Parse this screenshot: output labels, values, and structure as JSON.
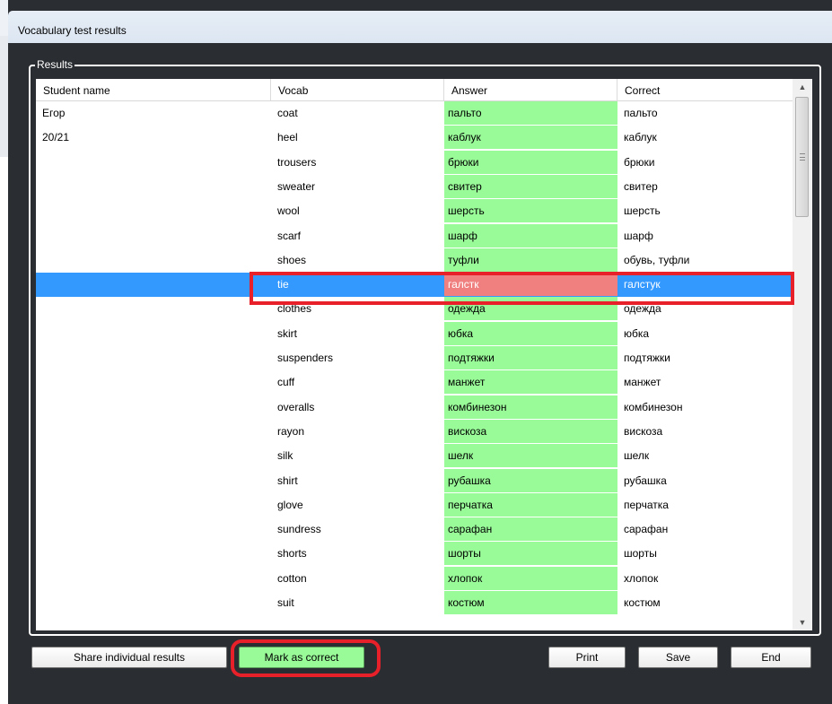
{
  "window": {
    "title": "Vocabulary test results"
  },
  "group": {
    "label": "Results"
  },
  "table": {
    "headers": [
      "Student name",
      "Vocab",
      "Answer",
      "Correct"
    ],
    "rows": [
      {
        "name": "Егор",
        "vocab": "coat",
        "answer": "пальто",
        "correct": "пальто",
        "status": "correct"
      },
      {
        "name": "20/21",
        "vocab": "heel",
        "answer": "каблук",
        "correct": "каблук",
        "status": "correct"
      },
      {
        "name": "",
        "vocab": "trousers",
        "answer": "брюки",
        "correct": "брюки",
        "status": "correct"
      },
      {
        "name": "",
        "vocab": "sweater",
        "answer": "свитер",
        "correct": "свитер",
        "status": "correct"
      },
      {
        "name": "",
        "vocab": "wool",
        "answer": "шерсть",
        "correct": "шерсть",
        "status": "correct"
      },
      {
        "name": "",
        "vocab": "scarf",
        "answer": "шарф",
        "correct": "шарф",
        "status": "correct"
      },
      {
        "name": "",
        "vocab": "shoes",
        "answer": "туфли",
        "correct": "обувь, туфли",
        "status": "correct"
      },
      {
        "name": "",
        "vocab": "tie",
        "answer": "галстк",
        "correct": "галстук",
        "status": "wrong",
        "selected": true
      },
      {
        "name": "",
        "vocab": "clothes",
        "answer": "одежда",
        "correct": "одежда",
        "status": "correct"
      },
      {
        "name": "",
        "vocab": "skirt",
        "answer": "юбка",
        "correct": "юбка",
        "status": "correct"
      },
      {
        "name": "",
        "vocab": "suspenders",
        "answer": "подтяжки",
        "correct": "подтяжки",
        "status": "correct"
      },
      {
        "name": "",
        "vocab": "cuff",
        "answer": "манжет",
        "correct": "манжет",
        "status": "correct"
      },
      {
        "name": "",
        "vocab": "overalls",
        "answer": "комбинезон",
        "correct": "комбинезон",
        "status": "correct"
      },
      {
        "name": "",
        "vocab": "rayon",
        "answer": "вискоза",
        "correct": "вискоза",
        "status": "correct"
      },
      {
        "name": "",
        "vocab": "silk",
        "answer": "шелк",
        "correct": "шелк",
        "status": "correct"
      },
      {
        "name": "",
        "vocab": "shirt",
        "answer": "рубашка",
        "correct": "рубашка",
        "status": "correct"
      },
      {
        "name": "",
        "vocab": "glove",
        "answer": "перчатка",
        "correct": "перчатка",
        "status": "correct"
      },
      {
        "name": "",
        "vocab": "sundress",
        "answer": "сарафан",
        "correct": "сарафан",
        "status": "correct"
      },
      {
        "name": "",
        "vocab": "shorts",
        "answer": "шорты",
        "correct": "шорты",
        "status": "correct"
      },
      {
        "name": "",
        "vocab": "cotton",
        "answer": "хлопок",
        "correct": "хлопок",
        "status": "correct"
      },
      {
        "name": "",
        "vocab": "suit",
        "answer": "костюм",
        "correct": "костюм",
        "status": "correct"
      }
    ]
  },
  "buttons": {
    "share": "Share individual results",
    "mark_correct": "Mark as correct",
    "print": "Print",
    "save": "Save",
    "end": "End"
  },
  "colors": {
    "correct_answer": "#98fb98",
    "wrong_answer": "#f08080",
    "selection": "#3399ff",
    "annotation": "#e8202a"
  },
  "icons": {
    "scroll_up": "triangle-up-icon",
    "scroll_down": "triangle-down-icon"
  }
}
